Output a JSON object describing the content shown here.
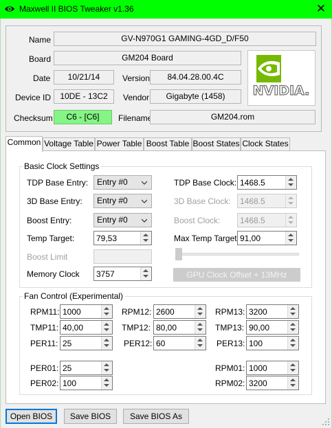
{
  "window": {
    "title": "Maxwell II BIOS Tweaker v1.36",
    "close_glyph": "✕",
    "app_icon": "nvidia-eye-icon",
    "titlebar_color": "#00ff00"
  },
  "info": {
    "name_label": "Name",
    "name_value": "GV-N970G1 GAMING-4GD_D/F50",
    "board_label": "Board",
    "board_value": "GM204 Board",
    "date_label": "Date",
    "date_value": "10/21/14",
    "version_label": "Version",
    "version_value": "84.04.28.00.4C",
    "device_id_label": "Device ID",
    "device_id_value": "10DE - 13C2",
    "vendor_label": "Vendor",
    "vendor_value": "Gigabyte (1458)",
    "checksum_label": "Checksum",
    "checksum_value": "C6 - [C6]",
    "checksum_color": "#85f585",
    "filename_label": "Filename",
    "filename_value": "GM204.rom",
    "logo_text": "NVIDIA.",
    "logo_icon": "nvidia-logo"
  },
  "tabs": [
    {
      "label": "Common",
      "active": true
    },
    {
      "label": "Voltage Table"
    },
    {
      "label": "Power Table"
    },
    {
      "label": "Boost Table"
    },
    {
      "label": "Boost States"
    },
    {
      "label": "Clock States"
    }
  ],
  "basic_clock": {
    "title": "Basic Clock Settings",
    "tdp_base_entry_label": "TDP Base Entry:",
    "tdp_base_entry_value": "Entry #0",
    "base_3d_entry_label": "3D Base Entry:",
    "base_3d_entry_value": "Entry #0",
    "boost_entry_label": "Boost Entry:",
    "boost_entry_value": "Entry #0",
    "temp_target_label": "Temp Target:",
    "temp_target_value": "79,53",
    "boost_limit_label": "Boost Limit",
    "boost_limit_value": "",
    "memory_clock_label": "Memory Clock",
    "memory_clock_value": "3757",
    "tdp_base_clock_label": "TDP Base Clock:",
    "tdp_base_clock_value": "1468.5",
    "base_3d_clock_label": "3D Base Clock:",
    "base_3d_clock_value": "1468.5",
    "boost_clock_label": "Boost Clock:",
    "boost_clock_value": "1468.5",
    "max_temp_target_label": "Max Temp Target:",
    "max_temp_target_value": "91,00",
    "gpu_offset_button": "GPU Clock Offset + 13MHz",
    "offset_slider_fraction": 0
  },
  "fan": {
    "title": "Fan Control (Experimental)",
    "rpm11_label": "RPM11:",
    "rpm11_value": "1000",
    "tmp11_label": "TMP11:",
    "tmp11_value": "40,00",
    "per11_label": "PER11:",
    "per11_value": "25",
    "rpm12_label": "RPM12:",
    "rpm12_value": "2600",
    "tmp12_label": "TMP12:",
    "tmp12_value": "80,00",
    "per12_label": "PER12:",
    "per12_value": "60",
    "rpm13_label": "RPM13:",
    "rpm13_value": "3200",
    "tmp13_label": "TMP13:",
    "tmp13_value": "90,00",
    "per13_label": "PER13:",
    "per13_value": "100",
    "per01_label": "PER01:",
    "per01_value": "25",
    "per02_label": "PER02:",
    "per02_value": "100",
    "rpm01_label": "RPM01:",
    "rpm01_value": "1000",
    "rpm02_label": "RPM02:",
    "rpm02_value": "3200"
  },
  "buttons": {
    "open": "Open BIOS",
    "save": "Save BIOS",
    "save_as": "Save BIOS As"
  },
  "colors": {
    "focus": "#0078d7",
    "nvidia_green": "#76b900"
  }
}
